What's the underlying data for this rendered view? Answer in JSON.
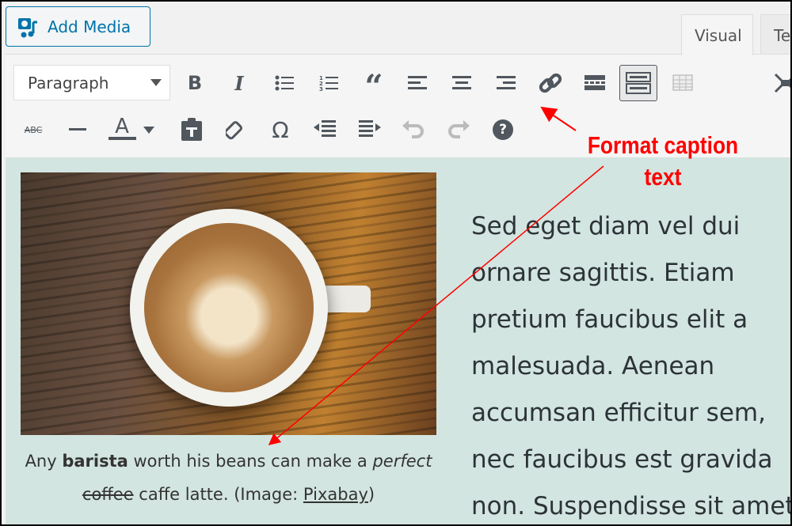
{
  "header": {
    "add_media_label": "Add Media",
    "tabs": [
      {
        "label": "Visual",
        "active": true
      },
      {
        "label": "Text",
        "active": false
      }
    ]
  },
  "toolbar": {
    "format_select": "Paragraph",
    "row1": [
      "bold",
      "italic",
      "bulleted-list",
      "numbered-list",
      "blockquote",
      "align-left",
      "align-center",
      "align-right",
      "insert-link",
      "read-more",
      "toolbar-toggle",
      "table",
      "fullscreen"
    ],
    "row2": [
      "strikethrough",
      "horizontal-line",
      "text-color",
      "text-color-dropdown",
      "paste-as-text",
      "clear-formatting",
      "special-character",
      "decrease-indent",
      "increase-indent",
      "undo",
      "redo",
      "help"
    ],
    "glyphs": {
      "bold": "B",
      "italic": "I",
      "abc": "ABC",
      "text_color": "A",
      "omega": "Ω",
      "help": "?"
    }
  },
  "content": {
    "caption": {
      "pre": "Any ",
      "bold": "barista",
      "mid": " worth his beans can make a ",
      "italic": "perfect",
      "strike": "coffee",
      "post": " caffe latte. (Image: ",
      "link": "Pixabay",
      "end": ")"
    },
    "body": "Sed eget diam vel dui ornare sagittis. Etiam pretium faucibus elit a malesuada. Aenean accumsan efficitur sem, nec faucibus est gravida non. Suspendisse sit amet"
  },
  "annotation": {
    "line1": "Format caption",
    "line2": "text",
    "color": "#ff0000"
  },
  "colors": {
    "accent": "#0073aa",
    "content_bg": "#d3e5e0",
    "icon": "#50575e"
  }
}
